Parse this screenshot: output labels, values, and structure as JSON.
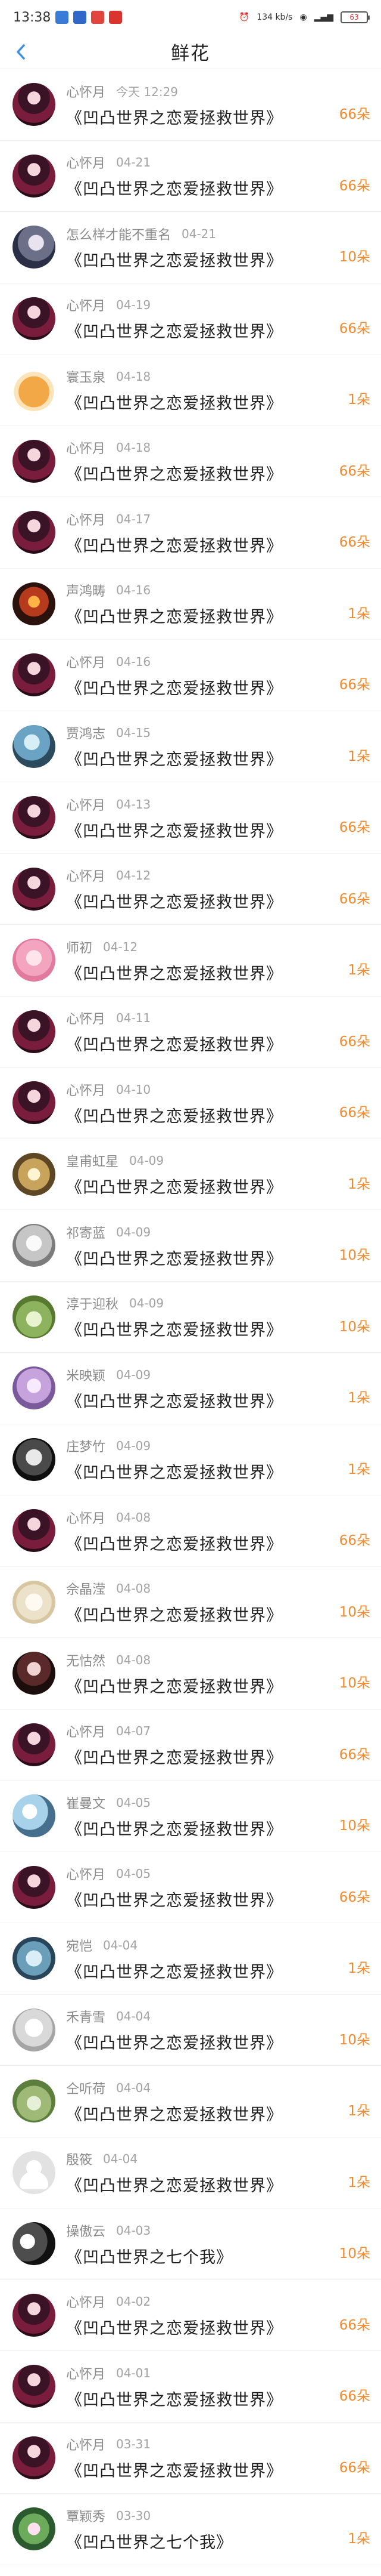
{
  "statusbar": {
    "time": "13:38",
    "battery": "63",
    "signal_text": "134 kb/s"
  },
  "navbar": {
    "title": "鲜花"
  },
  "entries": [
    {
      "user": "心怀月",
      "date": "今天 12:29",
      "book": "《凹凸世界之恋爱拯救世界》",
      "amount": "66朵",
      "avatar": "girl"
    },
    {
      "user": "心怀月",
      "date": "04-21",
      "book": "《凹凸世界之恋爱拯救世界》",
      "amount": "66朵",
      "avatar": "girl"
    },
    {
      "user": "怎么样才能不重名",
      "date": "04-21",
      "book": "《凹凸世界之恋爱拯救世界》",
      "amount": "10朵",
      "avatar": "anime"
    },
    {
      "user": "心怀月",
      "date": "04-19",
      "book": "《凹凸世界之恋爱拯救世界》",
      "amount": "66朵",
      "avatar": "girl"
    },
    {
      "user": "寰玉泉",
      "date": "04-18",
      "book": "《凹凸世界之恋爱拯救世界》",
      "amount": "1朵",
      "avatar": "cat"
    },
    {
      "user": "心怀月",
      "date": "04-18",
      "book": "《凹凸世界之恋爱拯救世界》",
      "amount": "66朵",
      "avatar": "girl"
    },
    {
      "user": "心怀月",
      "date": "04-17",
      "book": "《凹凸世界之恋爱拯救世界》",
      "amount": "66朵",
      "avatar": "girl"
    },
    {
      "user": "声鸿畴",
      "date": "04-16",
      "book": "《凹凸世界之恋爱拯救世界》",
      "amount": "1朵",
      "avatar": "fire"
    },
    {
      "user": "心怀月",
      "date": "04-16",
      "book": "《凹凸世界之恋爱拯救世界》",
      "amount": "66朵",
      "avatar": "girl"
    },
    {
      "user": "贾鸿志",
      "date": "04-15",
      "book": "《凹凸世界之恋爱拯救世界》",
      "amount": "1朵",
      "avatar": "blue"
    },
    {
      "user": "心怀月",
      "date": "04-13",
      "book": "《凹凸世界之恋爱拯救世界》",
      "amount": "66朵",
      "avatar": "girl"
    },
    {
      "user": "心怀月",
      "date": "04-12",
      "book": "《凹凸世界之恋爱拯救世界》",
      "amount": "66朵",
      "avatar": "girl"
    },
    {
      "user": "师初",
      "date": "04-12",
      "book": "《凹凸世界之恋爱拯救世界》",
      "amount": "1朵",
      "avatar": "pink"
    },
    {
      "user": "心怀月",
      "date": "04-11",
      "book": "《凹凸世界之恋爱拯救世界》",
      "amount": "66朵",
      "avatar": "girl"
    },
    {
      "user": "心怀月",
      "date": "04-10",
      "book": "《凹凸世界之恋爱拯救世界》",
      "amount": "66朵",
      "avatar": "girl"
    },
    {
      "user": "皇甫虹星",
      "date": "04-09",
      "book": "《凹凸世界之恋爱拯救世界》",
      "amount": "1朵",
      "avatar": "gold"
    },
    {
      "user": "祁寄蓝",
      "date": "04-09",
      "book": "《凹凸世界之恋爱拯救世界》",
      "amount": "10朵",
      "avatar": "gray"
    },
    {
      "user": "淳于迎秋",
      "date": "04-09",
      "book": "《凹凸世界之恋爱拯救世界》",
      "amount": "10朵",
      "avatar": "green"
    },
    {
      "user": "米映颖",
      "date": "04-09",
      "book": "《凹凸世界之恋爱拯救世界》",
      "amount": "1朵",
      "avatar": "purple"
    },
    {
      "user": "庄梦竹",
      "date": "04-09",
      "book": "《凹凸世界之恋爱拯救世界》",
      "amount": "1朵",
      "avatar": "skull"
    },
    {
      "user": "心怀月",
      "date": "04-08",
      "book": "《凹凸世界之恋爱拯救世界》",
      "amount": "66朵",
      "avatar": "girl"
    },
    {
      "user": "佘晶滢",
      "date": "04-08",
      "book": "《凹凸世界之恋爱拯救世界》",
      "amount": "10朵",
      "avatar": "beige"
    },
    {
      "user": "无怙然",
      "date": "04-08",
      "book": "《凹凸世界之恋爱拯救世界》",
      "amount": "10朵",
      "avatar": "dark"
    },
    {
      "user": "心怀月",
      "date": "04-07",
      "book": "《凹凸世界之恋爱拯救世界》",
      "amount": "66朵",
      "avatar": "girl"
    },
    {
      "user": "崔曼文",
      "date": "04-05",
      "book": "《凹凸世界之恋爱拯救世界》",
      "amount": "10朵",
      "avatar": "sky"
    },
    {
      "user": "心怀月",
      "date": "04-05",
      "book": "《凹凸世界之恋爱拯救世界》",
      "amount": "66朵",
      "avatar": "girl"
    },
    {
      "user": "宛恺",
      "date": "04-04",
      "book": "《凹凸世界之恋爱拯救世界》",
      "amount": "1朵",
      "avatar": "sea"
    },
    {
      "user": "禾青雪",
      "date": "04-04",
      "book": "《凹凸世界之恋爱拯救世界》",
      "amount": "10朵",
      "avatar": "sketch"
    },
    {
      "user": "仝听荷",
      "date": "04-04",
      "book": "《凹凸世界之恋爱拯救世界》",
      "amount": "1朵",
      "avatar": "totoro"
    },
    {
      "user": "殷筱",
      "date": "04-04",
      "book": "《凹凸世界之恋爱拯救世界》",
      "amount": "1朵",
      "avatar": "default"
    },
    {
      "user": "操傲云",
      "date": "04-03",
      "book": "《凹凸世界之七个我》",
      "amount": "10朵",
      "avatar": "profile"
    },
    {
      "user": "心怀月",
      "date": "04-02",
      "book": "《凹凸世界之恋爱拯救世界》",
      "amount": "66朵",
      "avatar": "girl"
    },
    {
      "user": "心怀月",
      "date": "04-01",
      "book": "《凹凸世界之恋爱拯救世界》",
      "amount": "66朵",
      "avatar": "girl"
    },
    {
      "user": "心怀月",
      "date": "03-31",
      "book": "《凹凸世界之恋爱拯救世界》",
      "amount": "66朵",
      "avatar": "girl"
    },
    {
      "user": "覃颖秀",
      "date": "03-30",
      "book": "《凹凸世界之七个我》",
      "amount": "1朵",
      "avatar": "flower"
    }
  ]
}
